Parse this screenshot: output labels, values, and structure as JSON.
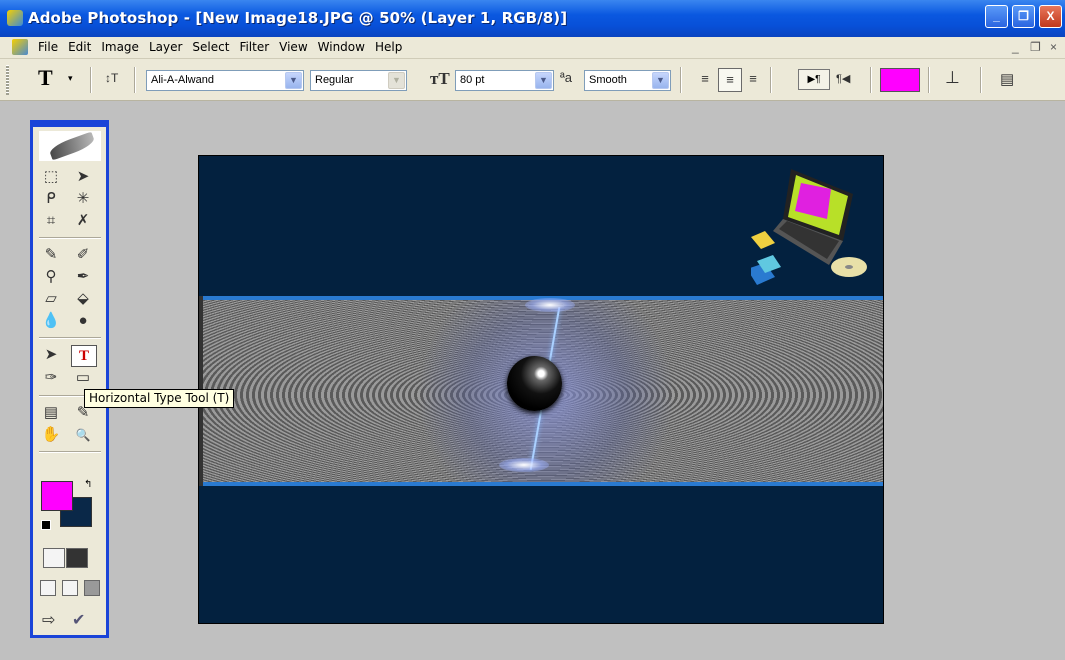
{
  "window": {
    "title": "Adobe Photoshop - [New Image18.JPG @ 50% (Layer 1, RGB/8)]",
    "minimize_glyph": "_",
    "restore_glyph": "❐",
    "close_glyph": "X"
  },
  "menu": {
    "items": [
      "File",
      "Edit",
      "Image",
      "Layer",
      "Select",
      "Filter",
      "View",
      "Window",
      "Help"
    ],
    "doc_minimize": "_",
    "doc_restore": "❐",
    "doc_close": "×"
  },
  "options": {
    "tool_glyph": "T",
    "tool_caret": "▾",
    "orientation_glyph": "↕T",
    "font_family": "Ali-A-Alwand",
    "font_style": "Regular",
    "size_glyph": "ᴛT",
    "font_size": "80 pt",
    "aa_glyph": "ªa",
    "antialias": "Smooth",
    "align_left_glyph": "≡",
    "align_center_glyph": "≡",
    "align_right_glyph": "≡",
    "ltr_glyph": "▶¶",
    "rtl_glyph": "¶◀",
    "text_color": "#ff00ff",
    "warp_glyph": "⊥",
    "palette_glyph": "▤"
  },
  "toolbox": {
    "tools": {
      "marquee": "⬚",
      "move": "➤",
      "lasso": "ᑭ",
      "magic_wand": "✳",
      "crop": "⌗",
      "slice": "✗",
      "heal": "✎",
      "brush": "✐",
      "stamp": "⚲",
      "history_brush": "✒",
      "eraser": "▱",
      "bucket": "⬙",
      "blur": "💧",
      "dodge": "●",
      "path_select": "➤",
      "type": "T",
      "pen": "✑",
      "shape": "▭",
      "notes": "▤",
      "eyedropper": "✎",
      "hand": "✋",
      "zoom": "🔍"
    },
    "swap_glyph": "↰",
    "foreground_color": "#ff00ff",
    "background_color": "#0a2848"
  },
  "tooltip": {
    "text": "Horizontal Type Tool (T)"
  }
}
